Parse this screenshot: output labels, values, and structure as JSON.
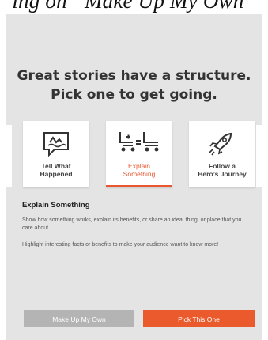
{
  "top_title": "ing on “Make Up My Own”",
  "headline_line1": "Great stories have a structure.",
  "headline_line2": "Pick one to get going.",
  "cards": [
    {
      "label": "Tell What\nHappened",
      "icon": "speech-bubble-shark-icon"
    },
    {
      "label": "Explain\nSomething",
      "icon": "skateboard-equals-skateboard-icon"
    },
    {
      "label": "Follow a\nHero’s Journey",
      "icon": "rocket-icon"
    }
  ],
  "description": {
    "title": "Explain Something",
    "line1": "Show how something works, explain its benefits, or share an idea, thing, or place that you care about.",
    "line2": "Highlight interesting facts or benefits to make your audience want to know more!"
  },
  "buttons": {
    "secondary": "Make Up My Own",
    "primary": "Pick This One"
  },
  "colors": {
    "accent": "#ea5a2c",
    "panel": "#e4e4e4",
    "secondary_button": "#b4b4b4"
  }
}
